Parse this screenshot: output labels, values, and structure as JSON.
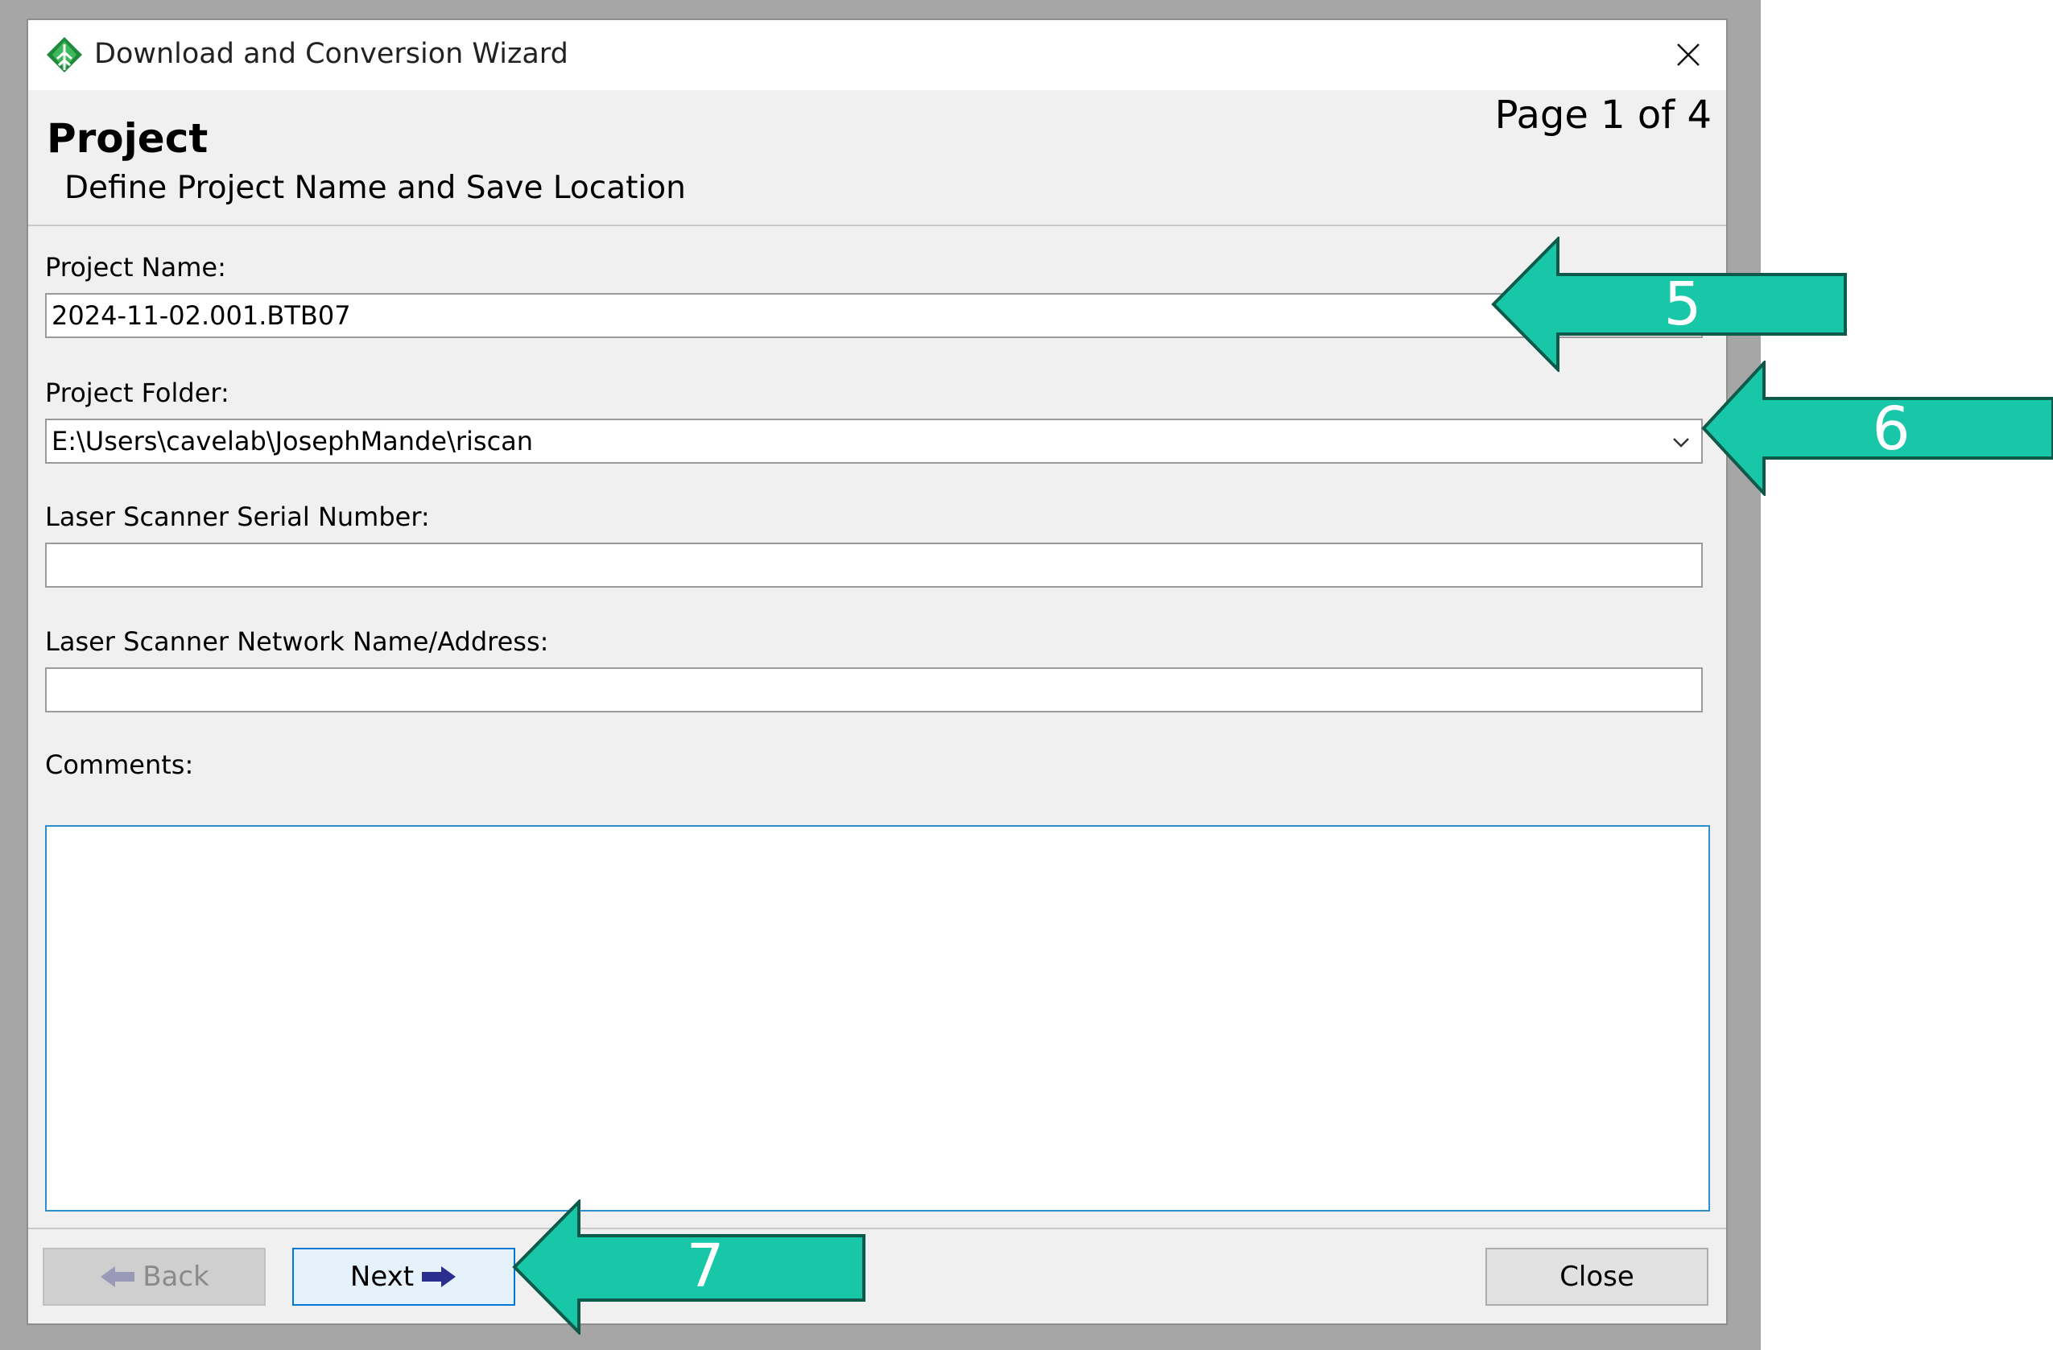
{
  "window": {
    "title": "Download and Conversion Wizard",
    "page_indicator": "Page 1 of 4",
    "page_title": "Project",
    "page_subtitle": "Define Project Name and Save Location"
  },
  "form": {
    "project_name_label": "Project Name:",
    "project_name_value": "2024-11-02.001.BTB07",
    "project_folder_label": "Project Folder:",
    "project_folder_value": "E:\\Users\\cavelab\\JosephMande\\riscan",
    "serial_label": "Laser Scanner Serial Number:",
    "serial_value": "",
    "network_label": "Laser Scanner Network Name/Address:",
    "network_value": "",
    "comments_label": "Comments:",
    "comments_value": ""
  },
  "buttons": {
    "back": "Back",
    "next": "Next",
    "close": "Close"
  },
  "annotations": {
    "color": "#17c7a8",
    "callouts": [
      "5",
      "6",
      "7"
    ]
  },
  "icons": [
    "app-tree-icon",
    "close-icon",
    "chevron-down-icon",
    "left-arrow-icon",
    "right-arrow-icon"
  ]
}
